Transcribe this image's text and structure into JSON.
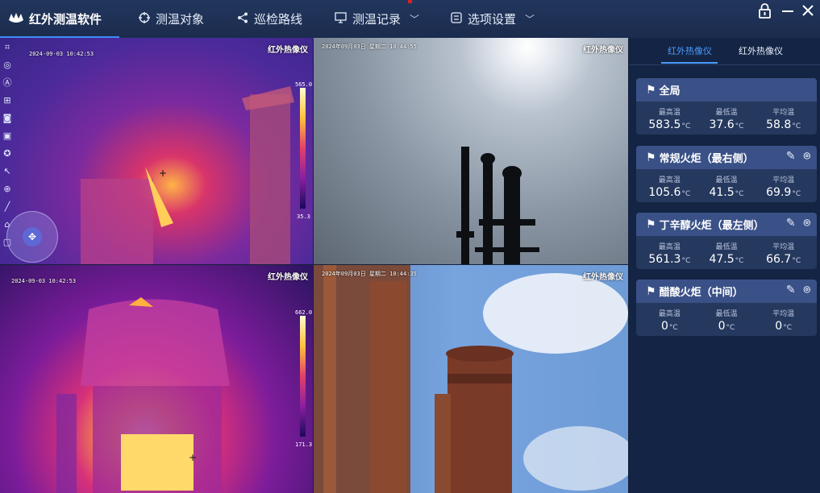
{
  "header": {
    "app_title": "红外测温软件",
    "nav": [
      {
        "label": "测温对象"
      },
      {
        "label": "巡检路线"
      },
      {
        "label": "测温记录"
      },
      {
        "label": "选项设置"
      }
    ]
  },
  "panes": [
    {
      "label": "红外热像仪",
      "timestamp": "2024-09-03 10:42:53",
      "scale_max": "565.0",
      "scale_min": "35.3"
    },
    {
      "label": "红外热像仪",
      "timestamp": "2024年09月03日  星期二  10:44:55"
    },
    {
      "label": "红外热像仪",
      "timestamp": "2024-09-03 10:42:53",
      "scale_max": "662.0",
      "scale_min": "171.3"
    },
    {
      "label": "红外热像仪",
      "timestamp": "2024年09月03日  星期二  10:44:35"
    }
  ],
  "sidebar": {
    "tabs": [
      {
        "label": "红外热像仪"
      },
      {
        "label": "红外热像仪"
      }
    ],
    "stat_labels": {
      "max": "最高温",
      "min": "最低温",
      "avg": "平均温"
    },
    "unit": "°C",
    "cards": [
      {
        "title": "全局",
        "max": "583.5",
        "min": "37.6",
        "avg": "58.8"
      },
      {
        "title": "常规火炬（最右侧）",
        "max": "105.6",
        "min": "41.5",
        "avg": "69.9"
      },
      {
        "title": "丁辛醇火炬（最左侧）",
        "max": "561.3",
        "min": "47.5",
        "avg": "66.7"
      },
      {
        "title": "醋酸火炬（中间）",
        "max": "0",
        "min": "0",
        "avg": "0"
      }
    ]
  },
  "icons": {
    "logo": "logo-icon",
    "target": "crosshair-target-icon",
    "route": "share-route-icon",
    "record": "monitor-record-icon",
    "settings": "settings-icon",
    "lock": "lock-icon",
    "minimize": "minimize-icon",
    "close": "close-icon",
    "flag": "flag-icon",
    "edit": "edit-pencil-icon",
    "location": "location-pin-icon"
  },
  "colors": {
    "accent": "#4a9bff",
    "card_head": "#3a5187",
    "card_body": "#25385e"
  }
}
